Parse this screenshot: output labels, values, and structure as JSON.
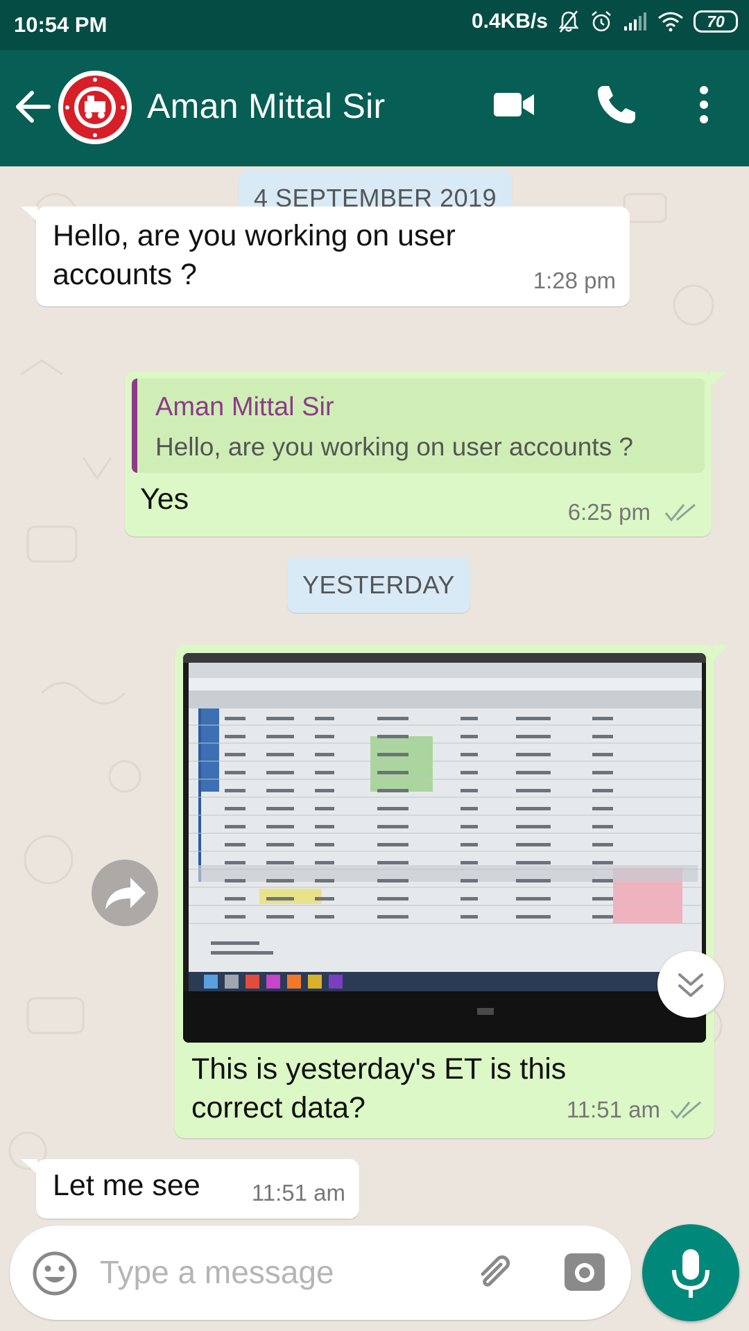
{
  "status_bar": {
    "time": "10:54 PM",
    "network_speed": "0.4KB/s",
    "battery": "70",
    "icons": [
      "mute-bell-icon",
      "alarm-icon",
      "signal-icon",
      "wifi-icon",
      "battery-icon"
    ]
  },
  "header": {
    "contact_name": "Aman Mittal Sir",
    "icons": [
      "back-arrow-icon",
      "avatar",
      "video-call-icon",
      "voice-call-icon",
      "more-options-icon"
    ],
    "color": "#075e54"
  },
  "chat": {
    "dates": [
      "4 SEPTEMBER 2019",
      "YESTERDAY"
    ],
    "messages": [
      {
        "direction": "in",
        "text_line1": "Hello, are you working on user",
        "text_line2": "accounts ?",
        "time": "1:28 pm"
      },
      {
        "direction": "out",
        "quote_author": "Aman Mittal Sir",
        "quote_text": "Hello, are you working on user accounts ?",
        "text": "Yes",
        "time": "6:25 pm",
        "status": "read-double-tick"
      },
      {
        "direction": "out",
        "type": "image",
        "caption_line1": "This is yesterday's ET is this",
        "caption_line2": "correct data?",
        "time": "11:51 am",
        "status": "double-tick"
      },
      {
        "direction": "in",
        "text": "Let me see",
        "time": "11:51 am"
      }
    ],
    "colors": {
      "incoming": "#ffffff",
      "outgoing": "#dcf8c6",
      "quote_accent": "#8e3a8a",
      "date_chip": "#d7eaf6"
    }
  },
  "input": {
    "placeholder": "Type a message",
    "icons": [
      "emoji-icon",
      "attach-icon",
      "camera-icon",
      "mic-icon"
    ]
  }
}
